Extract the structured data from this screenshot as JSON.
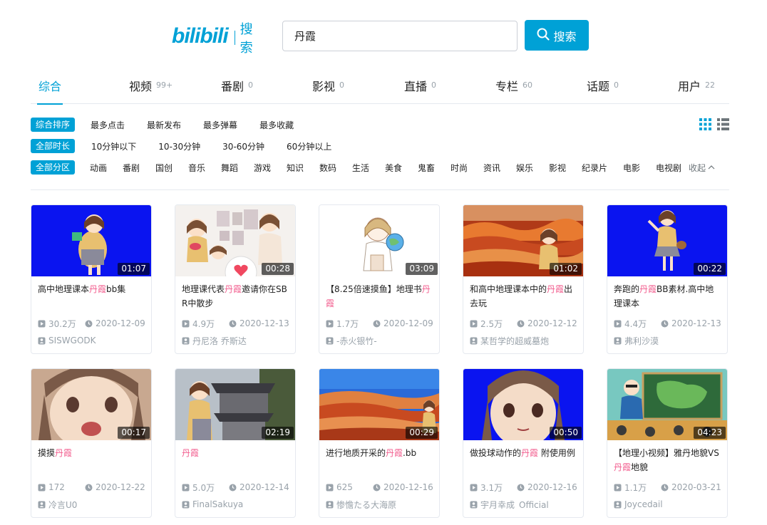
{
  "header": {
    "logo_text": "bilibili",
    "logo_sub": "搜索",
    "search_value": "丹霞",
    "search_button_label": "搜索"
  },
  "tabs": [
    {
      "label": "综合",
      "count": "",
      "active": true
    },
    {
      "label": "视频",
      "count": "99+"
    },
    {
      "label": "番剧",
      "count": "0"
    },
    {
      "label": "影视",
      "count": "0"
    },
    {
      "label": "直播",
      "count": "0"
    },
    {
      "label": "专栏",
      "count": "60"
    },
    {
      "label": "话题",
      "count": "0"
    },
    {
      "label": "用户",
      "count": "22"
    }
  ],
  "filters": {
    "sort": {
      "active": "综合排序",
      "options": [
        "最多点击",
        "最新发布",
        "最多弹幕",
        "最多收藏"
      ]
    },
    "duration": {
      "active": "全部时长",
      "options": [
        "10分钟以下",
        "10-30分钟",
        "30-60分钟",
        "60分钟以上"
      ]
    },
    "zone": {
      "active": "全部分区",
      "options": [
        "动画",
        "番剧",
        "国创",
        "音乐",
        "舞蹈",
        "游戏",
        "知识",
        "数码",
        "生活",
        "美食",
        "鬼畜",
        "时尚",
        "资讯",
        "娱乐",
        "影视",
        "纪录片",
        "电影",
        "电视剧"
      ],
      "collapse_label": "收起"
    }
  },
  "accent_color": "#00a1d6",
  "highlight_color": "#f25d8e",
  "videos": [
    {
      "duration": "01:07",
      "title_parts": [
        {
          "t": "高中地理课本"
        },
        {
          "t": "丹霞",
          "hl": true
        },
        {
          "t": "bb集"
        }
      ],
      "plays": "30.2万",
      "date": "2020-12-09",
      "uploader": "SISWGODK",
      "thumb": "blue-girl-book"
    },
    {
      "duration": "00:28",
      "title_parts": [
        {
          "t": "地理课代表"
        },
        {
          "t": "丹霞",
          "hl": true
        },
        {
          "t": "邀请你在SBR中散步"
        }
      ],
      "plays": "4.9万",
      "date": "2020-12-13",
      "uploader": "丹尼洛 乔斯达",
      "thumb": "sketch-collage"
    },
    {
      "duration": "03:09",
      "title_parts": [
        {
          "t": "【8.25倍速摸鱼】地理书"
        },
        {
          "t": "丹霞",
          "hl": true
        }
      ],
      "plays": "1.7万",
      "date": "2020-12-09",
      "uploader": "-赤火银竹-",
      "thumb": "drawing-globe"
    },
    {
      "duration": "01:02",
      "title_parts": [
        {
          "t": "和高中地理课本中的"
        },
        {
          "t": "丹霞",
          "hl": true
        },
        {
          "t": "出去玩"
        }
      ],
      "plays": "2.5万",
      "date": "2020-12-12",
      "uploader": "某哲学的超威墓炮",
      "thumb": "rainbow-mountains-girl"
    },
    {
      "duration": "00:22",
      "title_parts": [
        {
          "t": "奔跑的"
        },
        {
          "t": "丹霞",
          "hl": true
        },
        {
          "t": "BB素材.高中地理课本"
        }
      ],
      "plays": "4.4万",
      "date": "2020-12-13",
      "uploader": "弗利沙漠",
      "thumb": "blue-girl-running"
    },
    {
      "duration": "00:17",
      "title_parts": [
        {
          "t": "摸摸"
        },
        {
          "t": "丹霞",
          "hl": true
        }
      ],
      "plays": "172",
      "date": "2020-12-22",
      "uploader": "冷言U0",
      "thumb": "closeup-face"
    },
    {
      "duration": "02:19",
      "title_parts": [
        {
          "t": "丹霞",
          "hl": true
        }
      ],
      "plays": "5.0万",
      "date": "2020-12-14",
      "uploader": "FinalSakuya",
      "thumb": "temple-girl"
    },
    {
      "duration": "00:29",
      "title_parts": [
        {
          "t": "进行地质开采的"
        },
        {
          "t": "丹霞",
          "hl": true
        },
        {
          "t": ".bb"
        }
      ],
      "plays": "625",
      "date": "2020-12-16",
      "uploader": "惨憺たる大海原",
      "thumb": "red-landscape"
    },
    {
      "duration": "00:50",
      "title_parts": [
        {
          "t": "做投球动作的"
        },
        {
          "t": "丹霞",
          "hl": true
        },
        {
          "t": " 附使用例"
        }
      ],
      "plays": "3.1万",
      "date": "2020-12-16",
      "uploader": "宇月幸成_Official",
      "thumb": "blue-face"
    },
    {
      "duration": "04:23",
      "title_parts": [
        {
          "t": "【地理小视频】雅丹地貌VS"
        },
        {
          "t": "丹霞",
          "hl": true
        },
        {
          "t": "地貌"
        }
      ],
      "plays": "1.1万",
      "date": "2020-03-21",
      "uploader": "Joycedail",
      "thumb": "classroom-teacher"
    }
  ]
}
